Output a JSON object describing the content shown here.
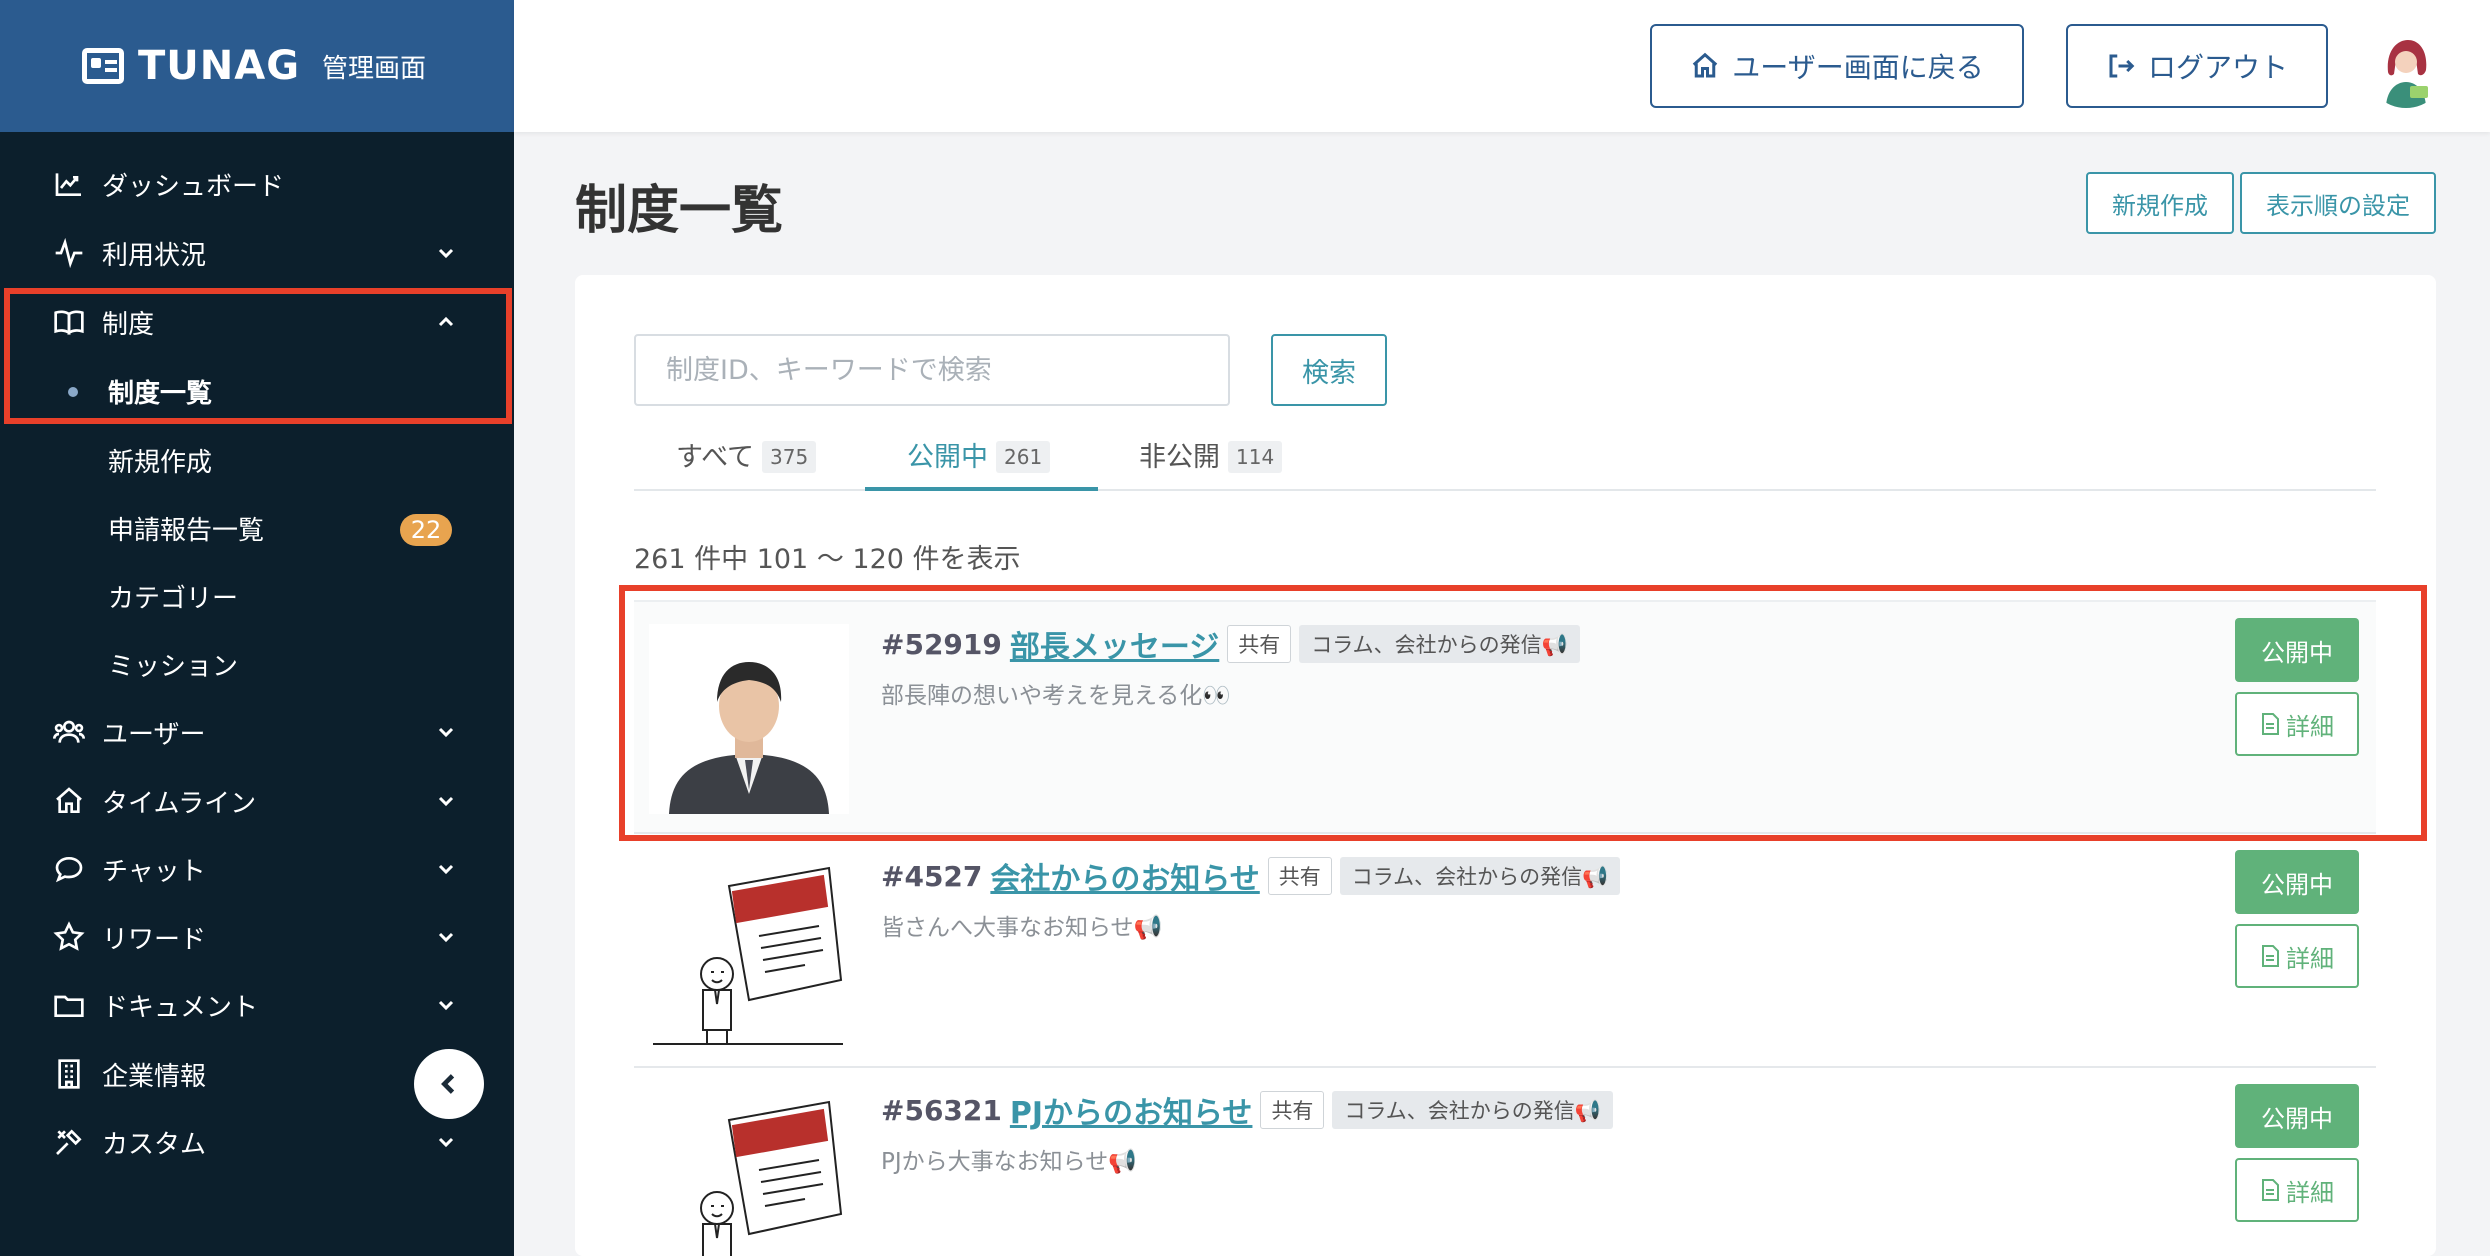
{
  "brand": {
    "name": "TUNAG",
    "subtitle": "管理画面"
  },
  "sidebar": {
    "items": [
      {
        "label": "ダッシュボード",
        "icon": "chart-line-icon"
      },
      {
        "label": "利用状況",
        "icon": "pulse-icon"
      },
      {
        "label": "制度",
        "icon": "book-icon"
      },
      {
        "label": "ユーザー",
        "icon": "users-icon"
      },
      {
        "label": "タイムライン",
        "icon": "home-icon"
      },
      {
        "label": "チャット",
        "icon": "chat-bubble-icon"
      },
      {
        "label": "リワード",
        "icon": "star-icon"
      },
      {
        "label": "ドキュメント",
        "icon": "folder-icon"
      },
      {
        "label": "企業情報",
        "icon": "building-icon"
      },
      {
        "label": "カスタム",
        "icon": "tools-icon"
      }
    ],
    "sub_items": [
      {
        "label": "制度一覧"
      },
      {
        "label": "新規作成"
      },
      {
        "label": "申請報告一覧",
        "badge": "22"
      },
      {
        "label": "カテゴリー"
      },
      {
        "label": "ミッション"
      }
    ]
  },
  "header": {
    "back_to_user_label": "ユーザー画面に戻る",
    "logout_label": "ログアウト"
  },
  "main": {
    "title": "制度一覧",
    "new_button": "新規作成",
    "order_button": "表示順の設定",
    "search": {
      "placeholder": "制度ID、キーワードで検索",
      "value": "",
      "button": "検索"
    },
    "tabs": [
      {
        "label": "すべて",
        "count": "375"
      },
      {
        "label": "公開中",
        "count": "261"
      },
      {
        "label": "非公開",
        "count": "114"
      }
    ],
    "result_count": "261 件中 101 〜 120 件を表示",
    "items": [
      {
        "id": "#52919",
        "title": "部長メッセージ",
        "share": "共有",
        "category": "コラム、会社からの発信📢",
        "description": "部長陣の想いや考えを見える化👀",
        "status": "公開中",
        "detail": "詳細"
      },
      {
        "id": "#4527",
        "title": "会社からのお知らせ",
        "share": "共有",
        "category": "コラム、会社からの発信📢",
        "description": "皆さんへ大事なお知らせ📢",
        "status": "公開中",
        "detail": "詳細"
      },
      {
        "id": "#56321",
        "title": "PJからのお知らせ",
        "share": "共有",
        "category": "コラム、会社からの発信📢",
        "description": "PJから大事なお知らせ📢",
        "status": "公開中",
        "detail": "詳細"
      }
    ]
  },
  "colors": {
    "sidebar_bg": "#0c1f2c",
    "brand_bg": "#2b5b8f",
    "accent": "#3a95a8",
    "status_green": "#60b27a",
    "badge_orange": "#e8a44f",
    "highlight_red": "#e8402a"
  }
}
